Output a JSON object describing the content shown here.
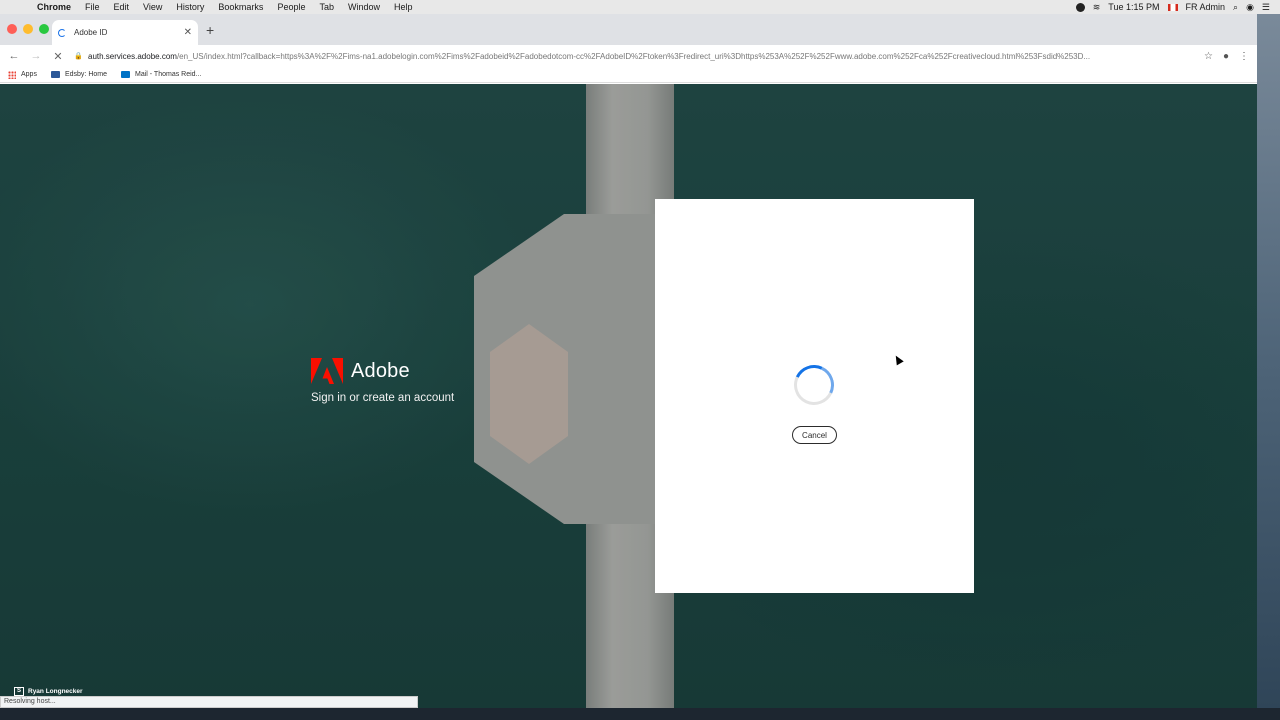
{
  "menubar": {
    "app_name": "Chrome",
    "items": [
      "File",
      "Edit",
      "View",
      "History",
      "Bookmarks",
      "People",
      "Tab",
      "Window",
      "Help"
    ],
    "clock": "Tue 1:15 PM",
    "user": "FR Admin"
  },
  "browser": {
    "tab_title": "Adobe ID",
    "url_host": "auth.services.adobe.com",
    "url_path": "/en_US/index.html?callback=https%3A%2F%2Fims-na1.adobelogin.com%2Fims%2Fadobeid%2Fadobedotcom-cc%2FAdobeID%2Ftoken%3Fredirect_uri%3Dhttps%253A%252F%252Fwww.adobe.com%252Fca%252Fcreativecloud.html%253Fsdid%253D...",
    "bookmarks": [
      {
        "label": "Apps",
        "icon": "apps-grid-icon"
      },
      {
        "label": "Edsby: Home",
        "icon": "edsby-icon"
      },
      {
        "label": "Mail - Thomas Reid...",
        "icon": "outlook-mail-icon"
      }
    ],
    "status_text": "Resolving host..."
  },
  "page": {
    "brand_name": "Adobe",
    "tagline": "Sign in or create an account",
    "dialog": {
      "cancel_label": "Cancel"
    }
  },
  "overlay": {
    "presenter_name": "Ryan Longnecker"
  },
  "colors": {
    "adobe_red": "#fa0f00",
    "spinner_blue": "#1473e6",
    "water": "#1f4f49"
  }
}
